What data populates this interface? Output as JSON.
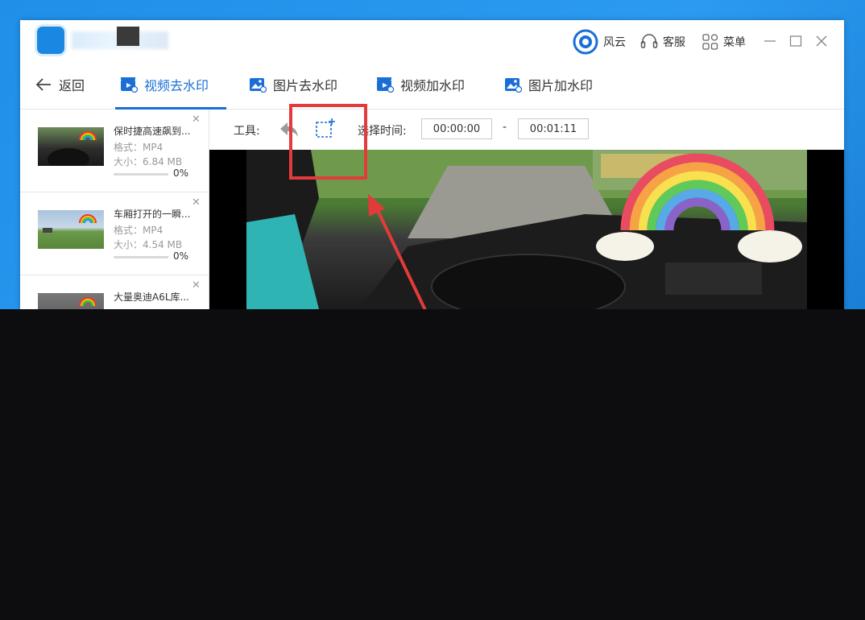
{
  "app": {
    "user_label": "风云",
    "service_label": "客服",
    "menu_label": "菜单"
  },
  "nav": {
    "back_label": "返回",
    "tabs": [
      {
        "label": "视频去水印",
        "active": true
      },
      {
        "label": "图片去水印",
        "active": false
      },
      {
        "label": "视频加水印",
        "active": false
      },
      {
        "label": "图片加水印",
        "active": false
      }
    ]
  },
  "files": [
    {
      "name": "保时捷高速飙到...",
      "format": "格式：MP4",
      "size": "大小：6.84 MB",
      "progress": "0%"
    },
    {
      "name": "车厢打开的一瞬...",
      "format": "格式：MP4",
      "size": "大小：4.54 MB",
      "progress": "0%"
    },
    {
      "name": "大量奥迪A6L库...",
      "format": "",
      "size": "",
      "progress": ""
    }
  ],
  "toolbar": {
    "tools_label": "工具:",
    "time_label": "选择时间:",
    "start_time": "00:00:00",
    "separator": "-",
    "end_time": "00:01:11"
  },
  "colors": {
    "accent": "#1a6fd6",
    "annotation": "#e33b3b"
  }
}
